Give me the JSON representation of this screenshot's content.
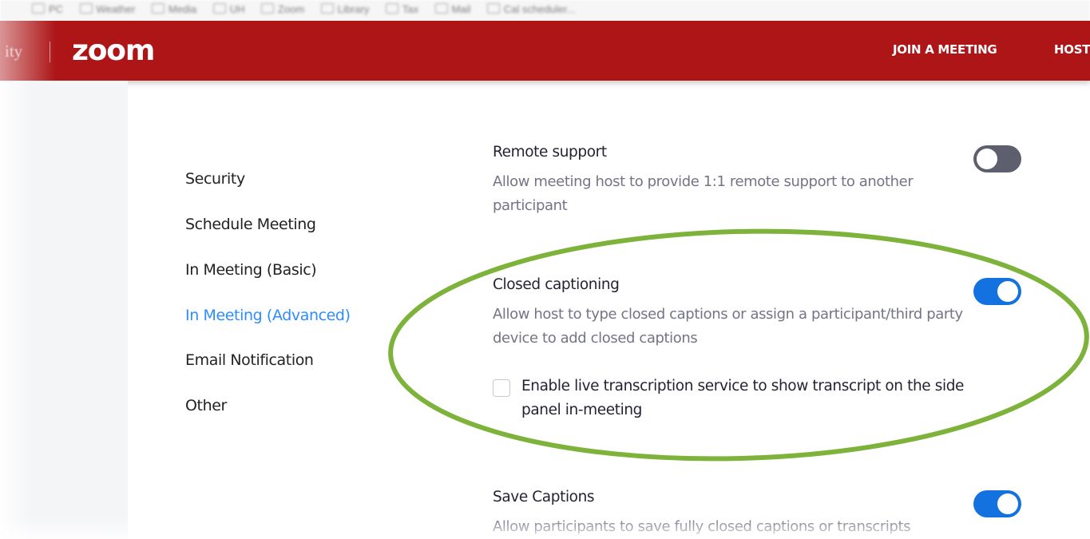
{
  "browser": {
    "bookmarks": [
      "PC",
      "Weather",
      "Media",
      "UH",
      "Zoom",
      "Library",
      "Tax",
      "Mail",
      "Cal scheduler..."
    ]
  },
  "header": {
    "org_fragment": "ity",
    "logo": "zoom",
    "nav": {
      "join": "JOIN A MEETING",
      "host": "HOST"
    },
    "background_color": "#ad1517"
  },
  "sidebar": {
    "items": [
      {
        "label": "Security",
        "active": false
      },
      {
        "label": "Schedule Meeting",
        "active": false
      },
      {
        "label": "In Meeting (Basic)",
        "active": false
      },
      {
        "label": "In Meeting (Advanced)",
        "active": true
      },
      {
        "label": "Email Notification",
        "active": false
      },
      {
        "label": "Other",
        "active": false
      }
    ],
    "active_color": "#2d8cff"
  },
  "settings": {
    "remote_support": {
      "title": "Remote support",
      "description": "Allow meeting host to provide 1:1 remote support to another participant",
      "enabled": false
    },
    "closed_captioning": {
      "title": "Closed captioning",
      "description": "Allow host to type closed captions or assign a participant/third party device to add closed captions",
      "enabled": true,
      "option": {
        "label": "Enable live transcription service to show transcript on the side panel in-meeting",
        "checked": false
      }
    },
    "save_captions": {
      "title": "Save Captions",
      "description": "Allow participants to save fully closed captions or transcripts",
      "enabled": true
    }
  },
  "colors": {
    "toggle_on": "#1471e0",
    "toggle_off": "#5d5e6e",
    "highlight": "#7db33b"
  }
}
